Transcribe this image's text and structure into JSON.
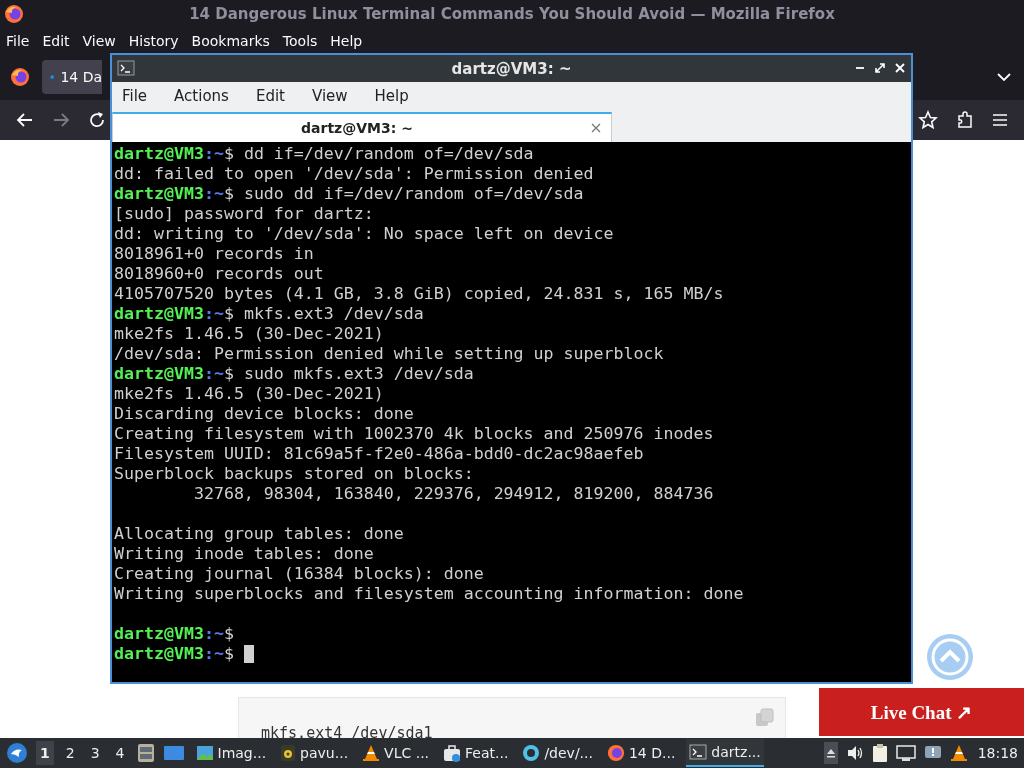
{
  "browser": {
    "title": "14 Dangerous Linux Terminal Commands You Should Avoid — Mozilla Firefox",
    "menu": [
      "File",
      "Edit",
      "View",
      "History",
      "Bookmarks",
      "Tools",
      "Help"
    ],
    "tab": {
      "label": "14 Da",
      "selected": true
    },
    "page": {
      "code": "mkfs.ext4 /dev/sda1",
      "live_chat": "Live Chat ↗"
    }
  },
  "terminal": {
    "title": "dartz@VM3: ~",
    "menu": [
      "File",
      "Actions",
      "Edit",
      "View",
      "Help"
    ],
    "tab": {
      "label": "dartz@VM3: ~",
      "selected": true
    },
    "lines": [
      {
        "kind": "prompt",
        "user": "dartz@VM3",
        "path": ":~",
        "command": "$ dd if=/dev/random of=/dev/sda"
      },
      {
        "kind": "output",
        "text": "dd: failed to open '/dev/sda': Permission denied"
      },
      {
        "kind": "prompt",
        "user": "dartz@VM3",
        "path": ":~",
        "command": "$ sudo dd if=/dev/random of=/dev/sda"
      },
      {
        "kind": "output",
        "text": "[sudo] password for dartz:"
      },
      {
        "kind": "output",
        "text": "dd: writing to '/dev/sda': No space left on device"
      },
      {
        "kind": "output",
        "text": "8018961+0 records in"
      },
      {
        "kind": "output",
        "text": "8018960+0 records out"
      },
      {
        "kind": "output",
        "text": "4105707520 bytes (4.1 GB, 3.8 GiB) copied, 24.831 s, 165 MB/s"
      },
      {
        "kind": "prompt",
        "user": "dartz@VM3",
        "path": ":~",
        "command": "$ mkfs.ext3 /dev/sda"
      },
      {
        "kind": "output",
        "text": "mke2fs 1.46.5 (30-Dec-2021)"
      },
      {
        "kind": "output",
        "text": "/dev/sda: Permission denied while setting up superblock"
      },
      {
        "kind": "prompt",
        "user": "dartz@VM3",
        "path": ":~",
        "command": "$ sudo mkfs.ext3 /dev/sda"
      },
      {
        "kind": "output",
        "text": "mke2fs 1.46.5 (30-Dec-2021)"
      },
      {
        "kind": "output",
        "text": "Discarding device blocks: done"
      },
      {
        "kind": "output",
        "text": "Creating filesystem with 1002370 4k blocks and 250976 inodes"
      },
      {
        "kind": "output",
        "text": "Filesystem UUID: 81c69a5f-f2e0-486a-bdd0-dc2ac98aefeb"
      },
      {
        "kind": "output",
        "text": "Superblock backups stored on blocks:"
      },
      {
        "kind": "output",
        "text": "        32768, 98304, 163840, 229376, 294912, 819200, 884736"
      },
      {
        "kind": "blank"
      },
      {
        "kind": "output",
        "text": "Allocating group tables: done"
      },
      {
        "kind": "output",
        "text": "Writing inode tables: done"
      },
      {
        "kind": "output",
        "text": "Creating journal (16384 blocks): done"
      },
      {
        "kind": "output",
        "text": "Writing superblocks and filesystem accounting information: done"
      },
      {
        "kind": "blank"
      },
      {
        "kind": "prompt",
        "user": "dartz@VM3",
        "path": ":~",
        "command": "$"
      },
      {
        "kind": "prompt",
        "user": "dartz@VM3",
        "path": ":~",
        "command": "$",
        "cursor": true
      }
    ]
  },
  "taskbar": {
    "workspaces": [
      {
        "label": "1",
        "selected": true
      },
      {
        "label": "2",
        "selected": false
      },
      {
        "label": "3",
        "selected": false
      },
      {
        "label": "4",
        "selected": false
      }
    ],
    "tasks": [
      {
        "label": "Imag...",
        "selected": false
      },
      {
        "label": "pavu...",
        "selected": false
      },
      {
        "label": "VLC ...",
        "selected": false
      },
      {
        "label": "Feat...",
        "selected": false
      },
      {
        "label": "/dev/...",
        "selected": false
      },
      {
        "label": "14 D...",
        "selected": false
      },
      {
        "label": "dartz...",
        "selected": true
      }
    ],
    "clock": "18:18"
  }
}
